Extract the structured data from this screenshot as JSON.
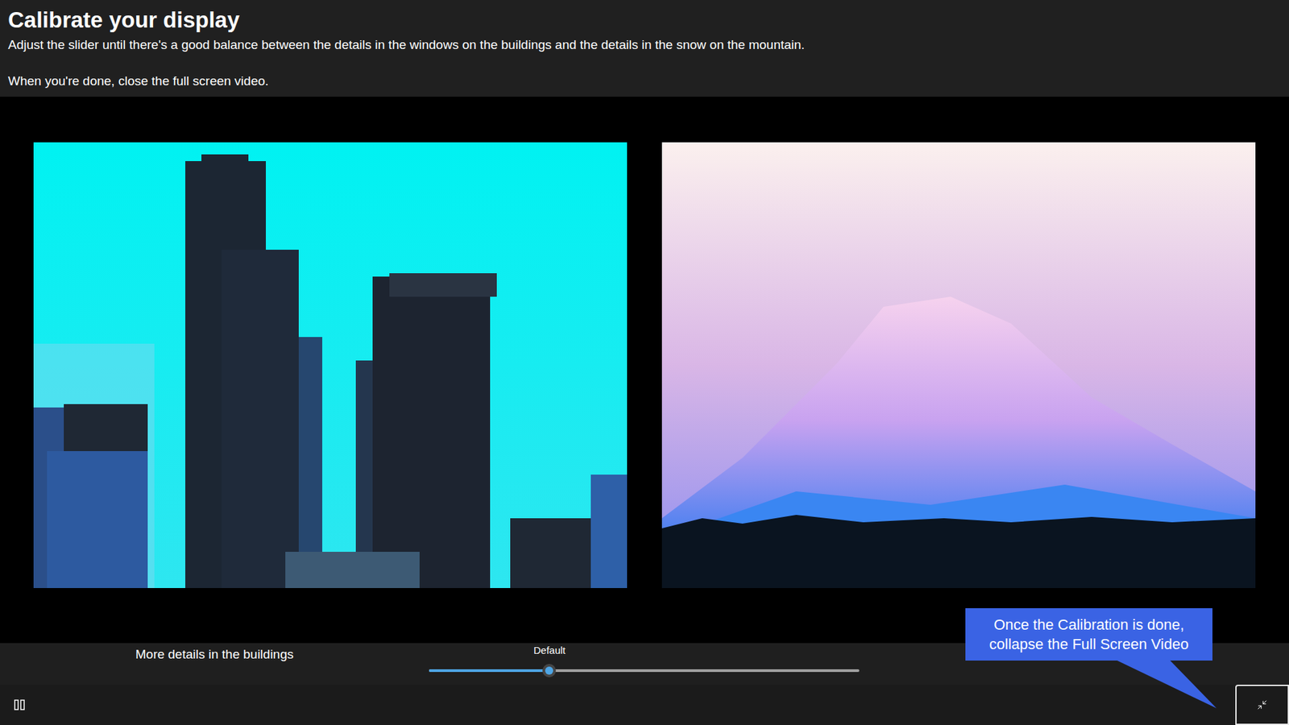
{
  "header": {
    "title": "Calibrate your display",
    "instructions": [
      "Adjust the slider until there's a good balance between the details in the windows on the buildings and the details in the snow on the mountain.",
      "When you're done, close the full screen video."
    ]
  },
  "slider": {
    "left_label": "More details in the buildings",
    "marker_label": "Default",
    "level": 0.28
  },
  "player": {
    "playing": true
  },
  "callout": {
    "text": "Once the Calibration is done, collapse the Full Screen Video"
  }
}
